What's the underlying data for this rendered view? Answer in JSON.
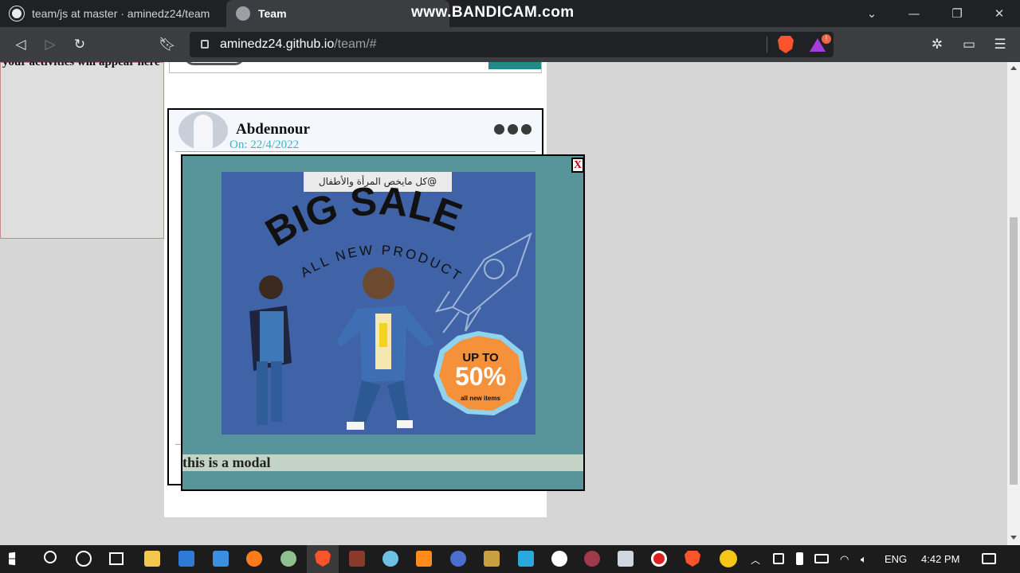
{
  "browser": {
    "tabs": [
      {
        "title": "team/js at master · aminedz24/team",
        "icon": "github-icon"
      },
      {
        "title": "Team",
        "icon": "globe-icon"
      }
    ],
    "watermark": "www.BANDICAM.com",
    "url_host": "aminedz24.github.io",
    "url_path": "/team/#",
    "rewards_badge": "!"
  },
  "page": {
    "activities_text": "your activities will appear here",
    "post": {
      "author": "Abdennour",
      "date": "On: 22/4/2022"
    },
    "modal": {
      "close_label": "X",
      "ad_tag": "@كل مايخص المرأة والأطفال",
      "ad_headline": "BIG SALE",
      "ad_subhead": "ALL NEW PRODUCTS",
      "ad_badge_top": "UP TO",
      "ad_badge_value": "50%",
      "ad_badge_bottom": "all new items",
      "caption": "this is a modal"
    }
  },
  "taskbar": {
    "language": "ENG",
    "time": "4:42 PM"
  },
  "colors": {
    "modal_bg": "#58959a",
    "ad_bg": "#4062a6",
    "badge_orange": "#f5913a",
    "date_color": "#39b4c8"
  }
}
